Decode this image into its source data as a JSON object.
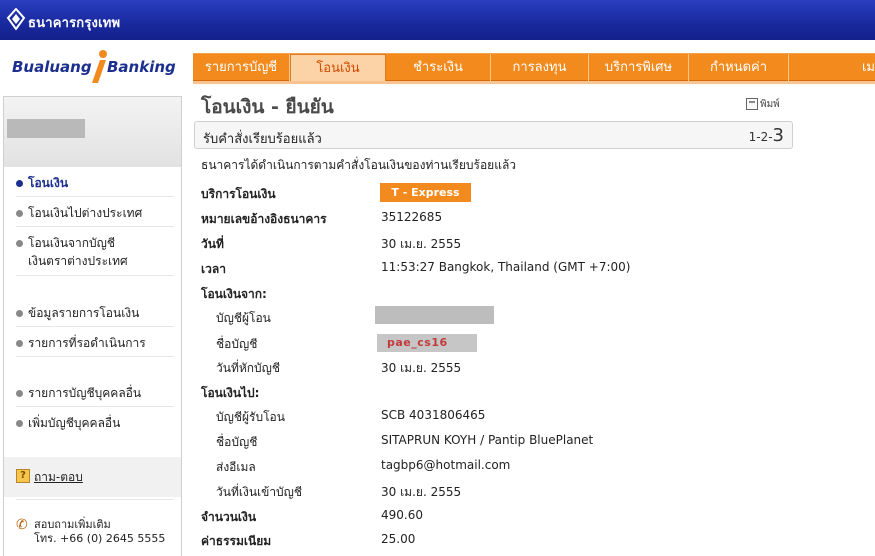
{
  "header": {
    "bank_name": "ธนาคารกรุงเทพ",
    "brand_left": "Bualuang",
    "brand_right": "Banking"
  },
  "nav": {
    "tabs": [
      {
        "label": "รายการบัญชี",
        "active": false
      },
      {
        "label": "โอนเงิน",
        "active": true
      },
      {
        "label": "ชำระเงิน",
        "active": false
      },
      {
        "label": "การลงทุน",
        "active": false
      },
      {
        "label": "บริการพิเศษ",
        "active": false
      },
      {
        "label": "กำหนดค่า",
        "active": false
      },
      {
        "label": "เม",
        "active": false
      }
    ]
  },
  "sidebar": {
    "items": [
      {
        "label": "โอนเงิน",
        "active": true
      },
      {
        "label": "โอนเงินไปต่างประเทศ",
        "active": false
      },
      {
        "label": "โอนเงินจากบัญชี",
        "label2": "เงินตราต่างประเทศ",
        "active": false
      },
      {
        "label": "ข้อมูลรายการโอนเงิน",
        "active": false
      },
      {
        "label": "รายการที่รอดำเนินการ",
        "active": false
      },
      {
        "label": "รายการบัญชีบุคคลอื่น",
        "active": false
      },
      {
        "label": "เพิ่มบัญชีบุคคลอื่น",
        "active": false
      }
    ],
    "help_label": "ถาม-ตอบ",
    "contact_title": "สอบถามเพิ่มเติม",
    "contact_phone": "โทร. +66 (0) 2645 5555"
  },
  "main": {
    "title": "โอนเงิน - ยืนยัน",
    "print_label": "พิมพ์",
    "status_label": "รับคำสั่งเรียบร้อยแล้ว",
    "steps_prefix": "1-2-",
    "steps_current": "3",
    "intro": "ธนาคารได้ดำเนินการตามคำสั่งโอนเงินของท่านเรียบร้อยแล้ว",
    "service_label": "บริการโอนเงิน",
    "service_value": "T - Express",
    "ref_label": "หมายเลขอ้างอิงธนาคาร",
    "ref_value": "35122685",
    "date_label": "วันที่",
    "date_value": "30 เม.ย. 2555",
    "time_label": "เวลา",
    "time_value": "11:53:27 Bangkok, Thailand (GMT +7:00)",
    "from_label": "โอนเงินจาก:",
    "from_account_label": "บัญชีผู้โอน",
    "from_name_label": "ชื่อบัญชี",
    "from_name_value": "pae_cs16",
    "from_debit_label": "วันที่หักบัญชี",
    "from_debit_value": "30 เม.ย. 2555",
    "to_label": "โอนเงินไป:",
    "to_account_label": "บัญชีผู้รับโอน",
    "to_account_value": "SCB 4031806465",
    "to_name_label": "ชื่อบัญชี",
    "to_name_value": "SITAPRUN KOYH / Pantip BluePlanet",
    "to_email_label": "ส่งอีเมล",
    "to_email_value": "tagbp6@hotmail.com",
    "to_credit_label": "วันที่เงินเข้าบัญชี",
    "to_credit_value": "30 เม.ย. 2555",
    "amount_label": "จำนวนเงิน",
    "amount_value": "490.60",
    "fee_label": "ค่าธรรมเนียม",
    "fee_value": "25.00"
  },
  "colors": {
    "header_blue": "#1a2aa0",
    "nav_orange": "#f28a1e",
    "active_tab_bg": "#fbd3a6",
    "brand_blue": "#1b2f8f"
  }
}
